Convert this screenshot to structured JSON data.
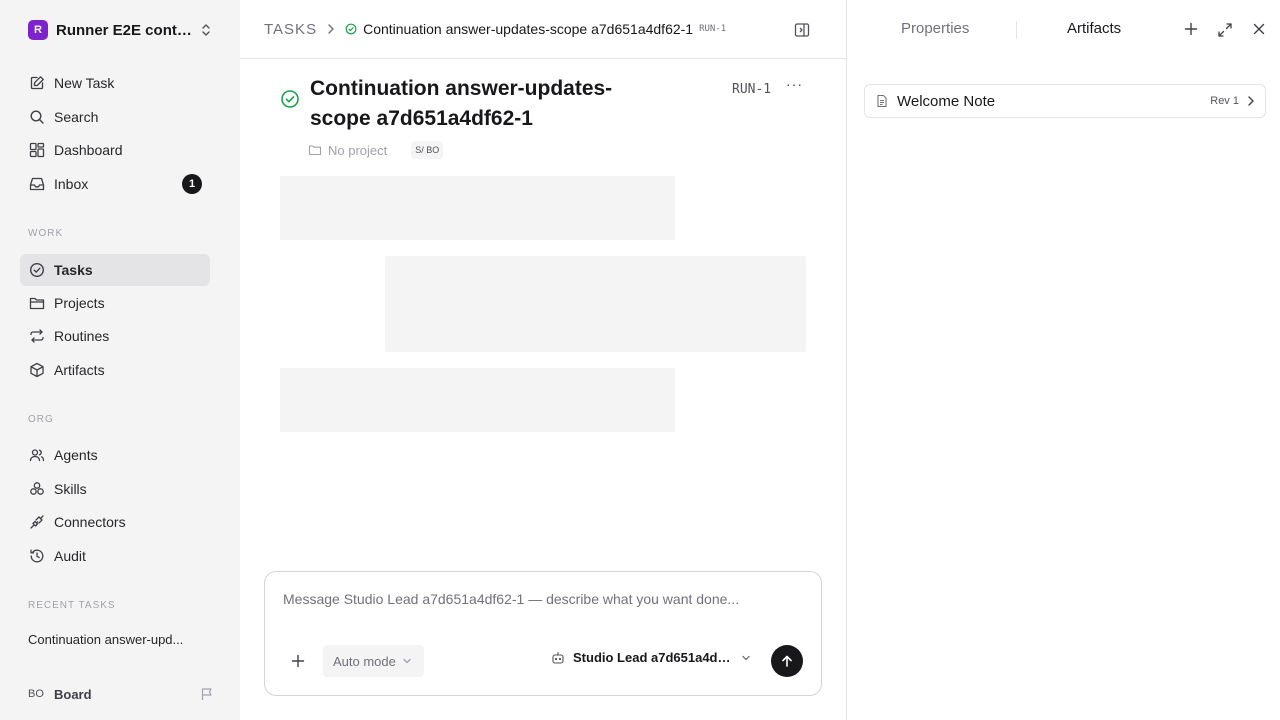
{
  "workspace": {
    "logo_letter": "R",
    "name": "Runner E2E conti..."
  },
  "nav": {
    "new_task": "New Task",
    "search": "Search",
    "dashboard": "Dashboard",
    "inbox": "Inbox",
    "inbox_count": "1"
  },
  "sections": {
    "work": "WORK",
    "org": "ORG",
    "recent": "RECENT TASKS"
  },
  "work_items": {
    "tasks": "Tasks",
    "projects": "Projects",
    "routines": "Routines",
    "artifacts": "Artifacts"
  },
  "org_items": {
    "agents": "Agents",
    "skills": "Skills",
    "connectors": "Connectors",
    "audit": "Audit"
  },
  "recent_tasks": [
    "Continuation answer-upd..."
  ],
  "user": {
    "initials": "BO",
    "name": "Board"
  },
  "breadcrumb": {
    "root": "TASKS",
    "title": "Continuation answer-updates-scope a7d651a4df62-1",
    "id": "RUN-1"
  },
  "task": {
    "title": "Continuation answer-updates-scope a7d651a4df62-1",
    "run_id": "RUN-1",
    "more": "···",
    "project": "No project",
    "assignee_chip": "S/ BO"
  },
  "composer": {
    "placeholder": "Message Studio Lead a7d651a4df62-1 — describe what you want done...",
    "mode": "Auto mode",
    "agent": "Studio Lead a7d651a4df6..."
  },
  "panel": {
    "tabs": [
      "Properties",
      "Artifacts"
    ],
    "active_tab": "Artifacts",
    "artifacts": [
      {
        "name": "Welcome Note",
        "rev": "Rev 1"
      }
    ]
  },
  "colors": {
    "accent": "#7e22ce",
    "success": "#16a34a",
    "sidebar_bg": "#f4f4f5",
    "active_item": "#e4e4e7"
  }
}
